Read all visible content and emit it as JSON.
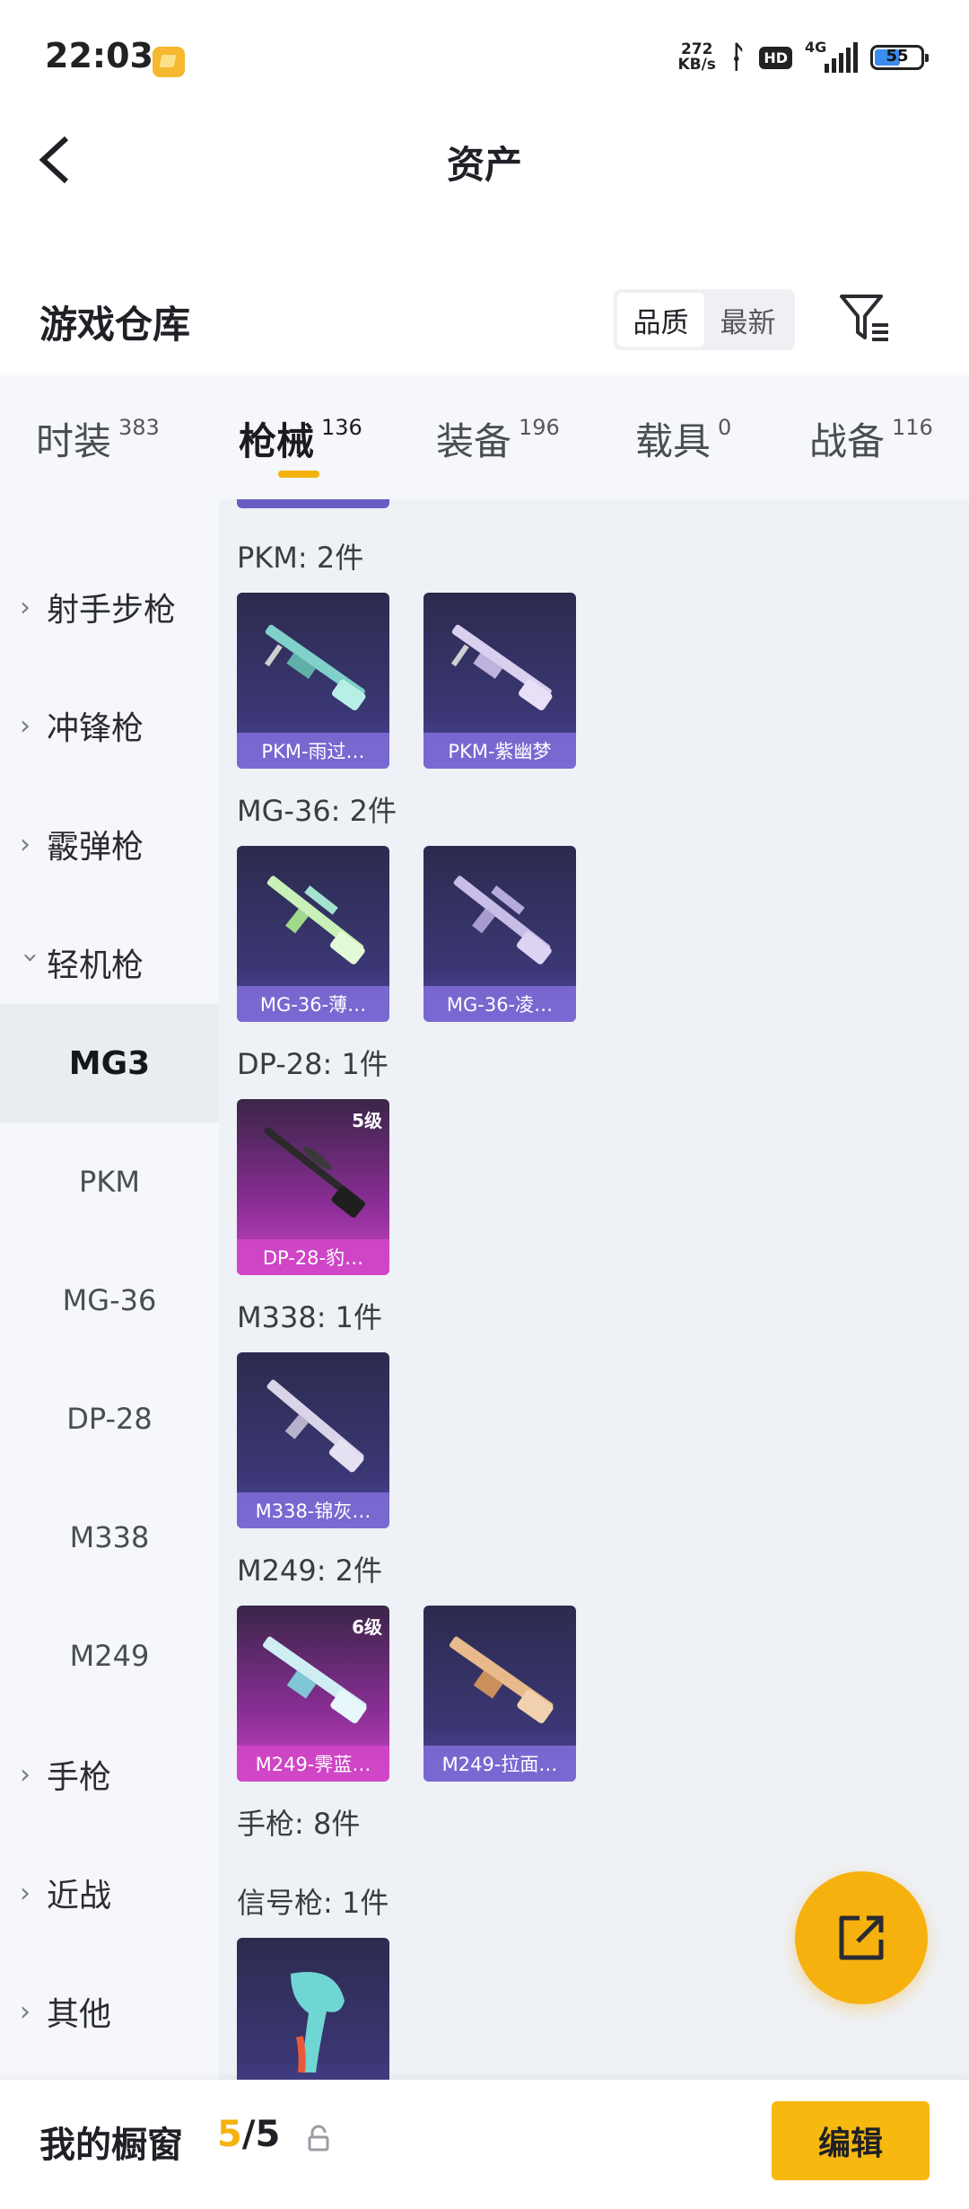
{
  "status_bar": {
    "time": "22:03",
    "net_speed_value": "272",
    "net_speed_unit": "KB/s",
    "network_type": "4G",
    "hd_label": "HD",
    "battery_level": "55"
  },
  "header": {
    "title": "资产"
  },
  "warehouse": {
    "title": "游戏仓库",
    "sort_options": [
      "品质",
      "最新"
    ],
    "sort_selected": "品质"
  },
  "tabs": [
    {
      "label": "时装",
      "count": "383"
    },
    {
      "label": "枪械",
      "count": "136"
    },
    {
      "label": "装备",
      "count": "196"
    },
    {
      "label": "载具",
      "count": "0"
    },
    {
      "label": "战备",
      "count": "116"
    }
  ],
  "active_tab": "枪械",
  "sidebar": {
    "categories": [
      {
        "label": "射手步枪",
        "expanded": false
      },
      {
        "label": "冲锋枪",
        "expanded": false
      },
      {
        "label": "霰弹枪",
        "expanded": false
      },
      {
        "label": "轻机枪",
        "expanded": true
      }
    ],
    "subitems": [
      "MG3",
      "PKM",
      "MG-36",
      "DP-28",
      "M338",
      "M249"
    ],
    "active_subitem": "MG3",
    "more_categories": [
      {
        "label": "手枪",
        "expanded": false
      },
      {
        "label": "近战",
        "expanded": false
      },
      {
        "label": "其他",
        "expanded": false
      }
    ]
  },
  "groups": [
    {
      "caption": "PKM: 2件",
      "items": [
        {
          "name": "PKM-雨过…",
          "rarity": "purple"
        },
        {
          "name": "PKM-紫幽梦",
          "rarity": "purple"
        }
      ]
    },
    {
      "caption": "MG-36: 2件",
      "items": [
        {
          "name": "MG-36-薄…",
          "rarity": "purple"
        },
        {
          "name": "MG-36-凌…",
          "rarity": "purple"
        }
      ]
    },
    {
      "caption": "DP-28: 1件",
      "items": [
        {
          "name": "DP-28-豹…",
          "rarity": "pink",
          "level": "5级"
        }
      ]
    },
    {
      "caption": "M338: 1件",
      "items": [
        {
          "name": "M338-锦灰…",
          "rarity": "purple"
        }
      ]
    },
    {
      "caption": "M249: 2件",
      "items": [
        {
          "name": "M249-霁蓝…",
          "rarity": "pink",
          "level": "6级"
        },
        {
          "name": "M249-拉面…",
          "rarity": "purple"
        }
      ]
    },
    {
      "caption": "手枪: 8件",
      "items": []
    },
    {
      "caption": "信号枪: 1件",
      "items": [
        {
          "name": "",
          "rarity": "purple"
        }
      ]
    }
  ],
  "bottom_bar": {
    "label": "我的橱窗",
    "current": "5",
    "separator_total": "/5",
    "edit_label": "编辑"
  },
  "colors": {
    "accent": "#f5b10c",
    "purple_card": "#3b3775",
    "pink_card": "#8a2e95",
    "sidebar_bg": "#f5f7fa",
    "content_bg": "#eef1f6"
  }
}
